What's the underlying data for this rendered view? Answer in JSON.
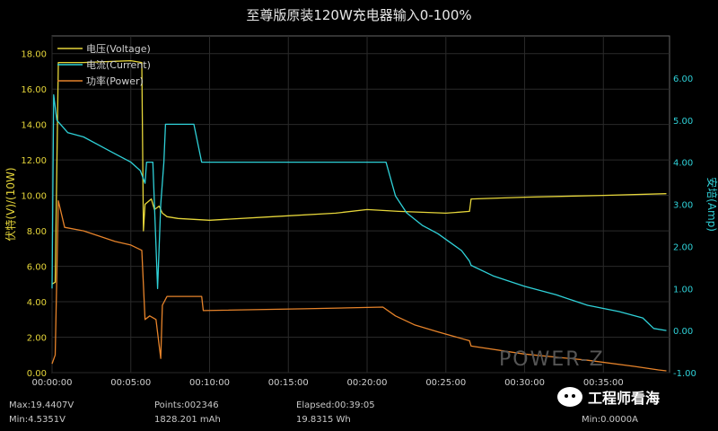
{
  "chart_data": {
    "type": "line",
    "title": "至尊版原装120W充电器输入0-100%",
    "ylabel_left": "伏特(V)/(10W)",
    "ylabel_right": "安培(Amp)",
    "ylim_left": [
      0,
      19
    ],
    "ylim_right": [
      -1,
      7
    ],
    "yticks_left": [
      "0.00",
      "2.00",
      "4.00",
      "6.00",
      "8.00",
      "10.00",
      "12.00",
      "14.00",
      "16.00",
      "18.00"
    ],
    "yticks_right": [
      "-1.00",
      "0.00",
      "1.00",
      "2.00",
      "3.00",
      "4.00",
      "5.00",
      "6.00"
    ],
    "xticks": [
      "00:00:00",
      "00:05:00",
      "00:10:00",
      "00:15:00",
      "00:20:00",
      "00:25:00",
      "00:30:00",
      "00:35:00"
    ],
    "xlim_minutes": [
      0,
      39.2
    ],
    "legend_placement": "top-left",
    "series": [
      {
        "name": "电压(Voltage)",
        "axis": "left",
        "color": "#e6d63a",
        "points": [
          [
            0,
            5.0
          ],
          [
            0.2,
            5.1
          ],
          [
            0.4,
            17.5
          ],
          [
            2.0,
            17.5
          ],
          [
            5.0,
            17.6
          ],
          [
            5.7,
            17.5
          ],
          [
            5.8,
            8.0
          ],
          [
            5.9,
            9.5
          ],
          [
            6.3,
            9.8
          ],
          [
            6.5,
            9.2
          ],
          [
            6.8,
            9.4
          ],
          [
            7.0,
            9.0
          ],
          [
            7.3,
            8.8
          ],
          [
            8.0,
            8.7
          ],
          [
            10,
            8.6
          ],
          [
            14,
            8.8
          ],
          [
            18,
            9.0
          ],
          [
            20,
            9.2
          ],
          [
            22,
            9.1
          ],
          [
            25,
            9.0
          ],
          [
            26.5,
            9.1
          ],
          [
            26.6,
            9.8
          ],
          [
            30,
            9.9
          ],
          [
            35,
            10.0
          ],
          [
            39,
            10.1
          ]
        ]
      },
      {
        "name": "电流(Current)",
        "axis": "right",
        "color": "#2fd1d8",
        "points": [
          [
            0,
            1.0
          ],
          [
            0.1,
            5.6
          ],
          [
            0.3,
            5.0
          ],
          [
            1.0,
            4.7
          ],
          [
            2.0,
            4.6
          ],
          [
            3.0,
            4.4
          ],
          [
            4.0,
            4.2
          ],
          [
            5.0,
            4.0
          ],
          [
            5.6,
            3.8
          ],
          [
            5.9,
            3.5
          ],
          [
            6.0,
            4.0
          ],
          [
            6.4,
            4.0
          ],
          [
            6.7,
            1.0
          ],
          [
            6.9,
            3.0
          ],
          [
            7.1,
            4.0
          ],
          [
            7.2,
            4.9
          ],
          [
            9.0,
            4.9
          ],
          [
            9.5,
            4.0
          ],
          [
            16,
            4.0
          ],
          [
            20,
            4.0
          ],
          [
            21.2,
            4.0
          ],
          [
            21.8,
            3.2
          ],
          [
            22.5,
            2.8
          ],
          [
            23.5,
            2.5
          ],
          [
            24.5,
            2.3
          ],
          [
            26,
            1.9
          ],
          [
            26.5,
            1.65
          ],
          [
            26.6,
            1.55
          ],
          [
            28,
            1.3
          ],
          [
            30,
            1.05
          ],
          [
            32,
            0.85
          ],
          [
            34,
            0.6
          ],
          [
            36,
            0.45
          ],
          [
            37.5,
            0.3
          ],
          [
            38.2,
            0.05
          ],
          [
            39,
            0.0
          ]
        ]
      },
      {
        "name": "功率(Power)",
        "axis": "left",
        "color": "#e6832a",
        "points": [
          [
            0,
            0.5
          ],
          [
            0.2,
            1.0
          ],
          [
            0.4,
            9.7
          ],
          [
            0.8,
            8.2
          ],
          [
            2.0,
            8.0
          ],
          [
            3.0,
            7.7
          ],
          [
            4.0,
            7.4
          ],
          [
            5.0,
            7.2
          ],
          [
            5.7,
            6.9
          ],
          [
            5.9,
            3.0
          ],
          [
            6.2,
            3.2
          ],
          [
            6.6,
            3.0
          ],
          [
            6.9,
            0.8
          ],
          [
            7.0,
            3.8
          ],
          [
            7.3,
            4.3
          ],
          [
            9.5,
            4.3
          ],
          [
            9.6,
            3.5
          ],
          [
            16,
            3.6
          ],
          [
            21,
            3.7
          ],
          [
            21.8,
            3.2
          ],
          [
            23,
            2.7
          ],
          [
            24.5,
            2.3
          ],
          [
            26.5,
            1.8
          ],
          [
            26.6,
            1.5
          ],
          [
            30,
            1.05
          ],
          [
            34,
            0.7
          ],
          [
            37,
            0.35
          ],
          [
            38.5,
            0.15
          ],
          [
            39,
            0.1
          ]
        ]
      }
    ]
  },
  "stats": {
    "max_v": "Max:19.4407V",
    "min_v": "Min:4.5351V",
    "points": "Points:002346",
    "mah": "1828.201 mAh",
    "elapsed": "Elapsed:00:39:05",
    "wh": "19.8315 Wh",
    "min_a": "Min:0.0000A"
  },
  "brand_text": "POWER-Z",
  "watermark_text": "工程师看海"
}
